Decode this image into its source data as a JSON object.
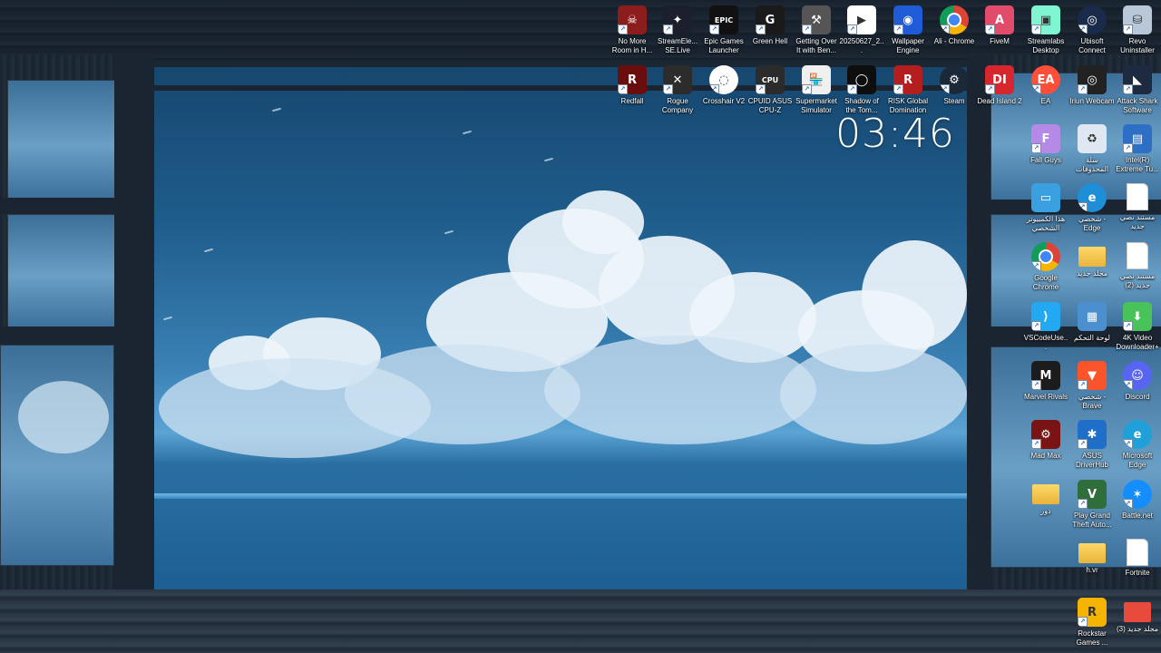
{
  "clock": {
    "time": "03:46"
  },
  "icons": [
    {
      "label": "No More Room in H...",
      "icon": "no-more-room-icon",
      "color": "#8c1d1d"
    },
    {
      "label": "StreamEle... SE.Live",
      "icon": "streamelements-icon",
      "color": "#1b1f2e"
    },
    {
      "label": "Epic Games Launcher",
      "icon": "epic-games-icon",
      "color": "#111111"
    },
    {
      "label": "Green Hell",
      "icon": "green-hell-icon",
      "color": "#1a1a1a"
    },
    {
      "label": "Getting Over It with Ben...",
      "icon": "hammer-icon",
      "color": "#555555"
    },
    {
      "label": "20250627_2...",
      "icon": "video-file-icon",
      "color": "#ffffff"
    },
    {
      "label": "Wallpaper Engine",
      "icon": "wallpaper-engine-icon",
      "color": "#1f5bd6"
    },
    {
      "label": "Ali - Chrome",
      "icon": "chrome-icon",
      "color": "#ffffff"
    },
    {
      "label": "FiveM",
      "icon": "fivem-icon",
      "color": "#e34b6a"
    },
    {
      "label": "Streamlabs Desktop",
      "icon": "streamlabs-icon",
      "color": "#80f5d2"
    },
    {
      "label": "Ubisoft Connect",
      "icon": "ubisoft-icon",
      "color": "#1a2a4a"
    },
    {
      "label": "Revo Uninstaller",
      "icon": "revo-icon",
      "color": "#b9c8d8"
    },
    {
      "label": "Redfall",
      "icon": "redfall-icon",
      "color": "#6a0d0d"
    },
    {
      "label": "Rogue Company",
      "icon": "rogue-company-icon",
      "color": "#2c2c2c"
    },
    {
      "label": "Crosshair V2",
      "icon": "crosshair-icon",
      "color": "#ffffff"
    },
    {
      "label": "CPUID ASUS CPU-Z",
      "icon": "cpu-z-icon",
      "color": "#2b2b2b"
    },
    {
      "label": "Supermarket Simulator",
      "icon": "supermarket-icon",
      "color": "#f0f0f0"
    },
    {
      "label": "Shadow of the Tom...",
      "icon": "shadow-tomb-icon",
      "color": "#0e0e0e"
    },
    {
      "label": "RISK Global Domination",
      "icon": "risk-icon",
      "color": "#b51e1e"
    },
    {
      "label": "Steam",
      "icon": "steam-icon",
      "color": "#1b2838"
    },
    {
      "label": "Dead Island 2",
      "icon": "dead-island-icon",
      "color": "#d8262e"
    },
    {
      "label": "EA",
      "icon": "ea-icon",
      "color": "#ff4e3a"
    },
    {
      "label": "Iriun Webcam",
      "icon": "iriun-webcam-icon",
      "color": "#222222"
    },
    {
      "label": "Attack Shark Software",
      "icon": "attack-shark-icon",
      "color": "#1d2a40"
    },
    {
      "label": "Fall Guys",
      "icon": "fall-guys-icon",
      "color": "#b58ae6"
    },
    {
      "label": "سلة المحذوفات",
      "icon": "recycle-bin-icon",
      "color": "#dfe8f2"
    },
    {
      "label": "Intel(R) Extreme Tu...",
      "icon": "intel-xtu-icon",
      "color": "#2d6fc4"
    },
    {
      "label": "هذا الكمبيوتر الشخصي",
      "icon": "this-pc-icon",
      "color": "#3aa0e0"
    },
    {
      "label": "شخصي - Edge",
      "icon": "edge-icon",
      "color": "#1f8ed8"
    },
    {
      "label": "مستند نصي جديد",
      "icon": "text-document-icon",
      "color": "#ffffff"
    },
    {
      "label": "Google Chrome",
      "icon": "chrome-icon",
      "color": "#ffffff"
    },
    {
      "label": "مجلد جديد",
      "icon": "folder-icon",
      "color": "#f2c14e"
    },
    {
      "label": "مستند نصي جديد (2)",
      "icon": "text-document-icon",
      "color": "#ffffff"
    },
    {
      "label": "VSCodeUse...",
      "icon": "vscode-icon",
      "color": "#23a9f2"
    },
    {
      "label": "لوحة التحكم",
      "icon": "control-panel-icon",
      "color": "#4c8fcf"
    },
    {
      "label": "4K Video Downloader+",
      "icon": "4k-downloader-icon",
      "color": "#47c35a"
    },
    {
      "label": "Marvel Rivals",
      "icon": "marvel-rivals-icon",
      "color": "#1c1c1c"
    },
    {
      "label": "شخصي - Brave",
      "icon": "brave-icon",
      "color": "#fb542b"
    },
    {
      "label": "Discord",
      "icon": "discord-icon",
      "color": "#5865f2"
    },
    {
      "label": "Mad Max",
      "icon": "mad-max-icon",
      "color": "#7a1414"
    },
    {
      "label": "ASUS DriverHub",
      "icon": "asus-driverhub-icon",
      "color": "#1f6fc9"
    },
    {
      "label": "Microsoft Edge",
      "icon": "edge-icon",
      "color": "#1fa0d8"
    },
    {
      "label": "دور",
      "icon": "folder-icon",
      "color": "#f2c14e"
    },
    {
      "label": "Play Grand Theft Auto...",
      "icon": "gta-icon",
      "color": "#2f6e3a"
    },
    {
      "label": "Battle.net",
      "icon": "battlenet-icon",
      "color": "#148eff"
    },
    {
      "label": "h.vr",
      "icon": "folder-icon",
      "color": "#f2c14e"
    },
    {
      "label": "Fortnite",
      "icon": "text-document-icon",
      "color": "#ffffff"
    },
    {
      "label": "Rockstar Games ...",
      "icon": "rockstar-icon",
      "color": "#f5b400"
    },
    {
      "label": "مجلد جديد (3)",
      "icon": "folder-icon",
      "color": "#e84b3c"
    }
  ]
}
